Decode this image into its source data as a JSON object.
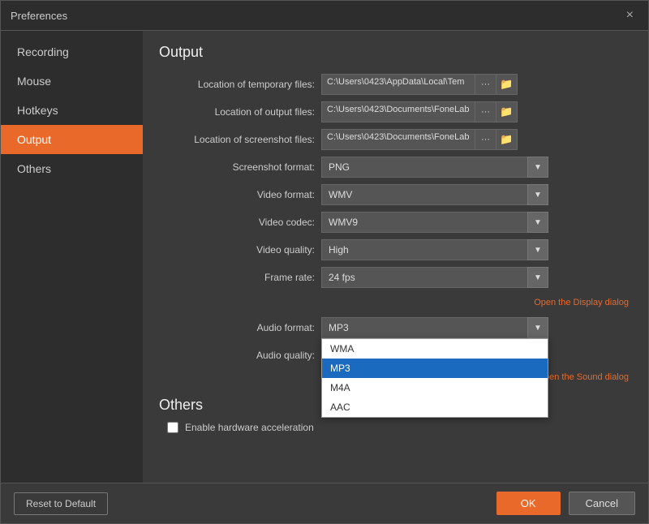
{
  "dialog": {
    "title": "Preferences",
    "close_label": "×"
  },
  "sidebar": {
    "items": [
      {
        "id": "recording",
        "label": "Recording",
        "active": false
      },
      {
        "id": "mouse",
        "label": "Mouse",
        "active": false
      },
      {
        "id": "hotkeys",
        "label": "Hotkeys",
        "active": false
      },
      {
        "id": "output",
        "label": "Output",
        "active": true
      },
      {
        "id": "others",
        "label": "Others",
        "active": false
      }
    ]
  },
  "main": {
    "output_title": "Output",
    "fields": {
      "temp_files_label": "Location of temporary files:",
      "temp_files_value": "C:\\Users\\0423\\AppData\\Local\\Tem",
      "output_files_label": "Location of output files:",
      "output_files_value": "C:\\Users\\0423\\Documents\\FoneLab",
      "screenshot_files_label": "Location of screenshot files:",
      "screenshot_files_value": "C:\\Users\\0423\\Documents\\FoneLab",
      "screenshot_format_label": "Screenshot format:",
      "screenshot_format_value": "PNG",
      "video_format_label": "Video format:",
      "video_format_value": "WMV",
      "video_codec_label": "Video codec:",
      "video_codec_value": "WMV9",
      "video_quality_label": "Video quality:",
      "video_quality_value": "High",
      "frame_rate_label": "Frame rate:",
      "frame_rate_value": "24 fps",
      "display_dialog_link": "Open the Display dialog",
      "audio_format_label": "Audio format:",
      "audio_format_value": "MP3",
      "audio_quality_label": "Audio quality:",
      "sound_dialog_link": "Open the Sound dialog"
    },
    "audio_dropdown": {
      "options": [
        {
          "id": "wma",
          "label": "WMA",
          "selected": false
        },
        {
          "id": "mp3",
          "label": "MP3",
          "selected": true
        },
        {
          "id": "m4a",
          "label": "M4A",
          "selected": false
        },
        {
          "id": "aac",
          "label": "AAC",
          "selected": false
        }
      ]
    },
    "others_title": "Others",
    "hardware_accel_label": "Enable hardware acceleration",
    "dots_label": "···",
    "folder_icon": "📁",
    "chevron_down": "▼"
  },
  "footer": {
    "reset_label": "Reset to Default",
    "ok_label": "OK",
    "cancel_label": "Cancel"
  }
}
